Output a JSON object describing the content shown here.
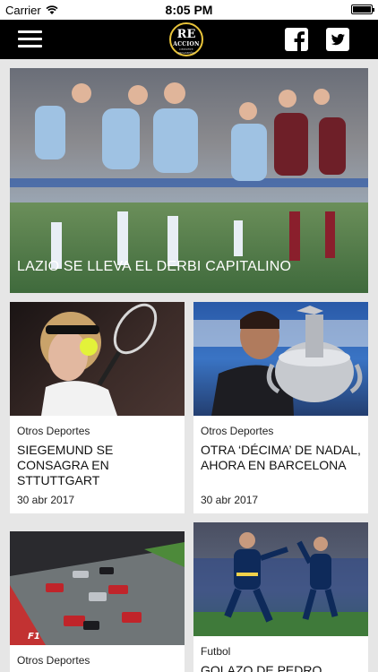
{
  "status": {
    "carrier": "Carrier",
    "time": "8:05 PM"
  },
  "nav": {
    "logo_line1": "RE",
    "logo_line2": "ACCION",
    "logo_line3": "DEPORTE PANAMEÑO"
  },
  "hero": {
    "title": "LAZIO SE LLEVA EL DERBI CAPITALINO"
  },
  "cards": [
    {
      "category": "Otros Deportes",
      "title": "SIEGEMUND SE CONSAGRA EN STTUTTGART",
      "date": "30 abr 2017"
    },
    {
      "category": "Otros Deportes",
      "title": "OTRA ‘DÉCIMA’ DE NADAL, AHORA EN BARCELONA",
      "date": "30 abr 2017"
    },
    {
      "category": "Otros Deportes",
      "title": "",
      "date": ""
    },
    {
      "category": "Futbol",
      "title": "GOLAZO DE PEDRO",
      "date": ""
    }
  ],
  "colors": {
    "nav": "#000000",
    "logo_ring": "#e8c33a",
    "background": "#e6e6e6"
  },
  "icons": {
    "menu": "hamburger-icon",
    "facebook": "facebook-icon",
    "twitter": "twitter-icon"
  }
}
